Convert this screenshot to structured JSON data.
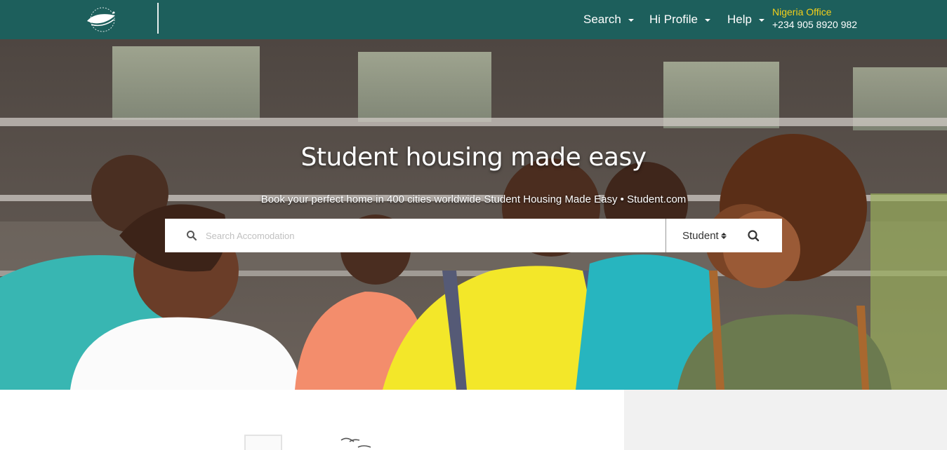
{
  "header": {
    "logo_icon": "globe-logo-icon",
    "nav": [
      {
        "label": "Search",
        "icon": "caret-down-icon"
      },
      {
        "label": "Hi Profile",
        "icon": "caret-down-icon"
      },
      {
        "label": "Help",
        "icon": "caret-down-icon"
      }
    ],
    "office": {
      "name": "Nigeria Office",
      "phone": "+234 905 8920 982"
    }
  },
  "hero": {
    "title": "Student housing made easy",
    "subtitle": "Book your perfect home in 400 cities worldwide Student Housing Made Easy • Student.com",
    "image": "group-of-smiling-students-photo"
  },
  "search": {
    "icon": "search-icon",
    "placeholder": "Search Accomodation",
    "value": "",
    "type_selected": "Student",
    "submit_icon": "search-icon"
  },
  "colors": {
    "navbar": "#1d5f5c",
    "office_name": "#f2cf1b",
    "right_panel": "#f1f1f1"
  }
}
